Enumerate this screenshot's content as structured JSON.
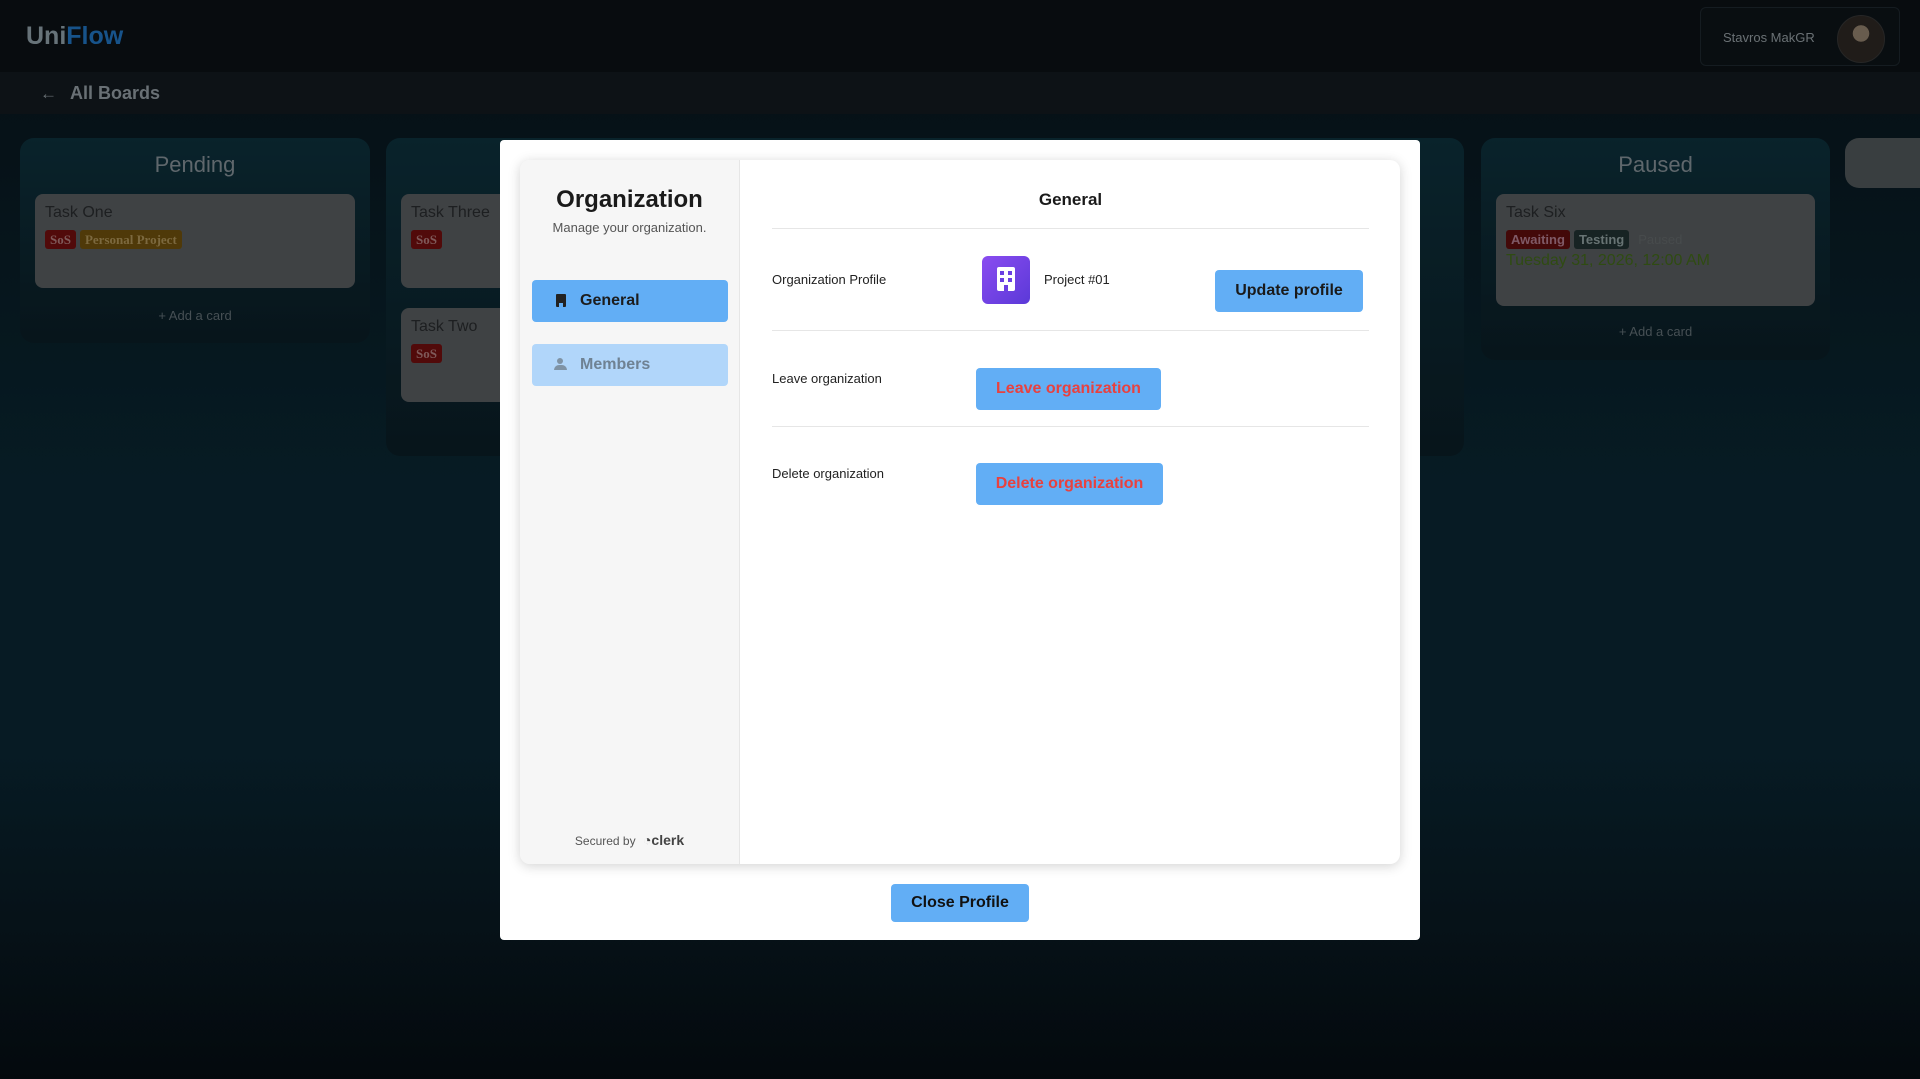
{
  "app": {
    "logo_part1": "Uni",
    "logo_part2": "Flow",
    "user_name": "Stavros MakGR",
    "back_label": "All Boards"
  },
  "board": {
    "columns": [
      {
        "title": "Pending",
        "cards": [
          {
            "title": "Task One",
            "tags": [
              "SoS",
              "Personal Project"
            ]
          }
        ],
        "add_card": "+ Add a card"
      },
      {
        "title": "",
        "cards": [
          {
            "title": "Task Three",
            "tags": [
              "SoS"
            ]
          },
          {
            "title": "Task Two",
            "tags": [
              "SoS"
            ]
          }
        ]
      },
      {
        "title": "Paused",
        "cards": [
          {
            "title": "Task Six",
            "tags": [
              "Awaiting",
              "Testing",
              "Paused"
            ],
            "date": "Tuesday 31, 2026, 12:00 AM"
          }
        ],
        "add_card": "+ Add a card"
      }
    ]
  },
  "modal": {
    "sidebar": {
      "title": "Organization",
      "subtitle": "Manage your organization.",
      "nav": [
        {
          "label": "General",
          "icon": "building-icon",
          "active": true
        },
        {
          "label": "Members",
          "icon": "members-icon",
          "active": false
        }
      ],
      "secured_by": "Secured by",
      "secured_brand": "clerk"
    },
    "main": {
      "title": "General",
      "profile_label": "Organization Profile",
      "org_name": "Project #01",
      "update_button": "Update profile",
      "leave_label": "Leave organization",
      "leave_button": "Leave organization",
      "delete_label": "Delete organization",
      "delete_button": "Delete organization"
    },
    "close_button": "Close Profile"
  },
  "colors": {
    "accent": "#62aef5",
    "danger": "#e8413f",
    "org_avatar": "#7c45ec"
  }
}
